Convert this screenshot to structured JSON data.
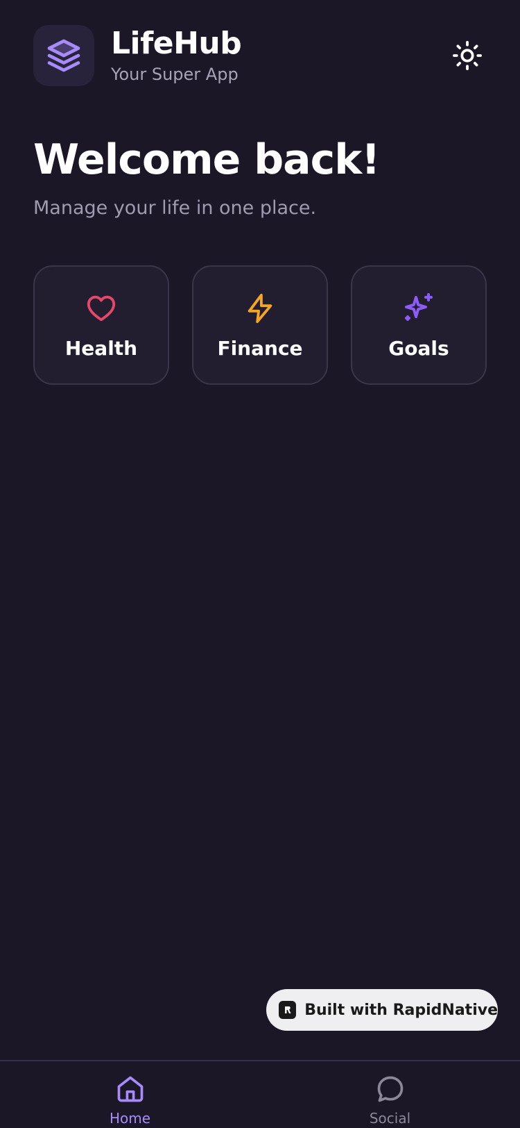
{
  "header": {
    "app_name": "LifeHub",
    "tagline": "Your Super App",
    "logo_icon": "layers-icon",
    "theme_toggle_icon": "sun-icon"
  },
  "hero": {
    "title": "Welcome back!",
    "subtitle": "Manage your life in one place."
  },
  "categories": [
    {
      "label": "Health",
      "icon": "heart-icon",
      "color": "#e5486b"
    },
    {
      "label": "Finance",
      "icon": "lightning-icon",
      "color": "#f5a524"
    },
    {
      "label": "Goals",
      "icon": "sparkles-icon",
      "color": "#8b5cf6"
    }
  ],
  "badge": {
    "label": "Built with RapidNative"
  },
  "tabs": [
    {
      "label": "Home",
      "icon": "home-icon",
      "active": true
    },
    {
      "label": "Social",
      "icon": "chat-bubble-icon",
      "active": false
    }
  ],
  "colors": {
    "background": "#1b1726",
    "accent": "#a78bfa",
    "card": "#221e30"
  }
}
